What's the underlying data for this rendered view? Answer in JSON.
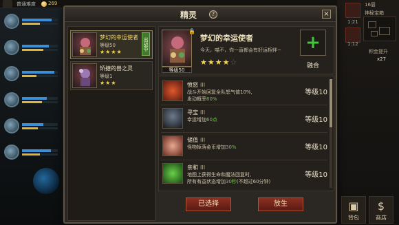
{
  "hud": {
    "mode_label": "普通难度",
    "gold": "269",
    "heroes": [
      {
        "hp": 0.82,
        "mp": 0.5
      },
      {
        "hp": 0.75,
        "mp": 0.6
      },
      {
        "hp": 0.9,
        "mp": 0.4
      },
      {
        "hp": 0.7,
        "mp": 0.55
      },
      {
        "hp": 0.6,
        "mp": 0.45
      },
      {
        "hp": 0.8,
        "mp": 0.5
      }
    ],
    "right": {
      "top_text": "16层",
      "timer1": "1:21",
      "timer2": "1:12",
      "map_label": "神秘宝箱",
      "chest_label": "积金提升",
      "multiplier": "x27",
      "bag_label": "背包",
      "shop_label": "商店"
    }
  },
  "dialog": {
    "title": "精灵",
    "help_glyph": "?",
    "close_glyph": "×",
    "spirits": [
      {
        "name": "梦幻的幸运使者",
        "level": "等级50",
        "stars": "★★★★",
        "badge": "出战中"
      },
      {
        "name": "矫捷的兽之灵",
        "level": "等级1",
        "stars": "★★★"
      }
    ],
    "detail": {
      "name": "梦幻的幸运使者",
      "level_tag": "等级50",
      "desc": "今天，喵不，你一直都会有好运相伴~",
      "stars_filled": "★★★★",
      "stars_empty": "☆",
      "fuse_glyph": "+",
      "fuse_label": "融合"
    },
    "skills": [
      {
        "name": "愤怒",
        "tier": "III",
        "desc_line1": "战斗开始回复全队怒气值10%,",
        "desc_line2_pre": "发动概率",
        "desc_line2_hl": "60%",
        "desc_line2_post": "",
        "level": "等级10"
      },
      {
        "name": "寻宝",
        "tier": "III",
        "desc_line1": "幸运增加",
        "desc_line1_hl": "60点",
        "level": "等级10"
      },
      {
        "name": "储值",
        "tier": "III",
        "desc_line1": "怪物掉落金币增加",
        "desc_line1_hl": "30%",
        "level": "等级10"
      },
      {
        "name": "亲和",
        "tier": "III",
        "desc_line1": "地图上获得生命和魔法回复时,",
        "desc_line2_pre": "所有有益状态增加",
        "desc_line2_hl": "30秒",
        "desc_line2_post": "(不超过60分钟)",
        "level": "等级10"
      }
    ],
    "buttons": {
      "selected": "已选择",
      "release": "放生"
    }
  }
}
